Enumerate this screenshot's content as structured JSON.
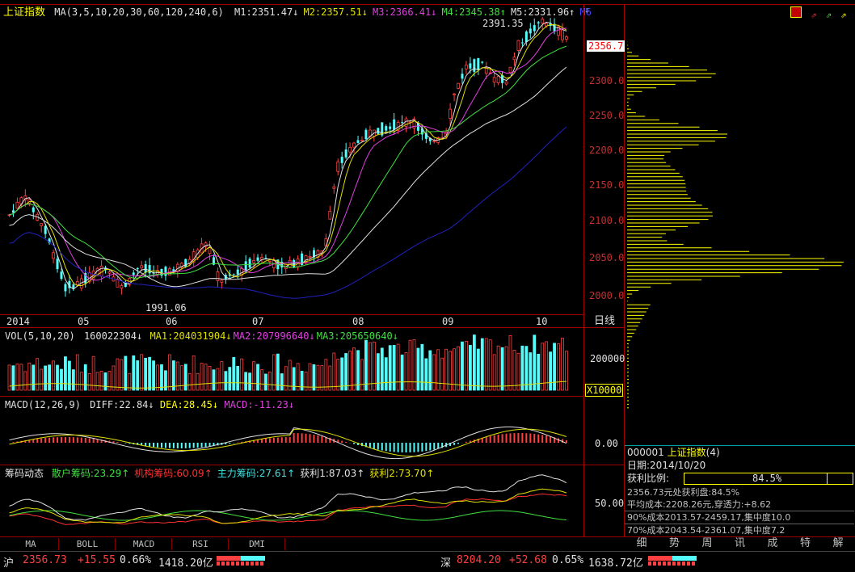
{
  "main_chart": {
    "title": "上证指数",
    "ma_label": "MA(3,5,10,20,30,60,120,240,6)",
    "ma_values": [
      {
        "text": "M1:2351.47",
        "arrow": "↓",
        "color": "#e0e0e0"
      },
      {
        "text": "M2:2357.51",
        "arrow": "↓",
        "color": "#e0e000"
      },
      {
        "text": "M3:2366.41",
        "arrow": "↓",
        "color": "#e040e0"
      },
      {
        "text": "M4:2345.38",
        "arrow": "↑",
        "color": "#40e040"
      },
      {
        "text": "M5:2331.96",
        "arrow": "↑",
        "color": "#e0e0e0"
      },
      {
        "text": "M6",
        "arrow": "",
        "color": "#4040ff"
      }
    ],
    "high_label": "2391.35",
    "low_label": "1991.06",
    "current_price": "2356.7",
    "y_axis": [
      "2300.0",
      "2250.0",
      "2200.0",
      "2150.0",
      "2100.0",
      "2050.0",
      "2000.0"
    ],
    "x_axis": [
      "2014",
      "05",
      "06",
      "07",
      "08",
      "09",
      "10"
    ],
    "period_label": "日线"
  },
  "volume_chart": {
    "label": "VOL(5,10,20)",
    "value": "160022304",
    "value_arrow": "↓",
    "ma": [
      {
        "text": "MA1:204031904",
        "arrow": "↓",
        "color": "#e0e000"
      },
      {
        "text": "MA2:207996640",
        "arrow": "↓",
        "color": "#e040e0"
      },
      {
        "text": "MA3:205650640",
        "arrow": "↓",
        "color": "#40e040"
      }
    ],
    "y_axis": [
      "200000"
    ],
    "unit": "X10000"
  },
  "macd_chart": {
    "label": "MACD(12,26,9)",
    "diff": "DIFF:22.84",
    "diff_arrow": "↓",
    "dea": "DEA:28.45",
    "dea_arrow": "↓",
    "macd": "MACD:-11.23",
    "macd_arrow": "↓",
    "y_axis": [
      "0.00"
    ]
  },
  "chip_chart": {
    "label": "筹码动态",
    "items": [
      {
        "text": "散户筹码:23.29",
        "arrow": "↑",
        "color": "#40e040"
      },
      {
        "text": "机构筹码:60.09",
        "arrow": "↑",
        "color": "#ff3030"
      },
      {
        "text": "主力筹码:27.61",
        "arrow": "↑",
        "color": "#40e0e0"
      },
      {
        "text": "获利1:87.03",
        "arrow": "↑",
        "color": "#e0e0e0"
      },
      {
        "text": "获利2:73.70",
        "arrow": "↑",
        "color": "#e0e000"
      }
    ],
    "y_axis": [
      "50.00"
    ]
  },
  "indicator_tabs": [
    "MA",
    "BOLL",
    "MACD",
    "RSI",
    "DMI"
  ],
  "info_panel": {
    "code": "000001",
    "name": "上证指数",
    "count": "(4)",
    "date": "日期:2014/10/20",
    "profit_ratio_label": "获利比例:",
    "profit_ratio_value": "84.5%",
    "profit_ratio_fraction": 0.845,
    "line1": "2356.73元处获利盘:84.5%",
    "line2": "平均成本:2208.26元,穿透力:+8.62",
    "line3": "90%成本2013.57-2459.17,集中度10.0",
    "line4": "70%成本2043.54-2361.07,集中度7.2"
  },
  "right_tabs": [
    "细",
    "势",
    "周",
    "讯",
    "成",
    "特",
    "解"
  ],
  "status_bar": {
    "sh_label": "沪",
    "sh_price": "2356.73",
    "sh_change": "+15.55",
    "sh_pct": "0.66%",
    "sh_amount": "1418.20亿",
    "sz_label": "深",
    "sz_price": "8204.20",
    "sz_change": "+52.68",
    "sz_pct": "0.65%",
    "sz_amount": "1638.72亿"
  },
  "colors": {
    "up": "#ff4040",
    "down": "#54fcfc",
    "yellow": "#ffff00",
    "frame": "#a00000",
    "ma1": "#e0e0e0",
    "ma2": "#e0e000",
    "ma3": "#e040e0",
    "ma4": "#40e040",
    "ma6": "#2020c0"
  }
}
